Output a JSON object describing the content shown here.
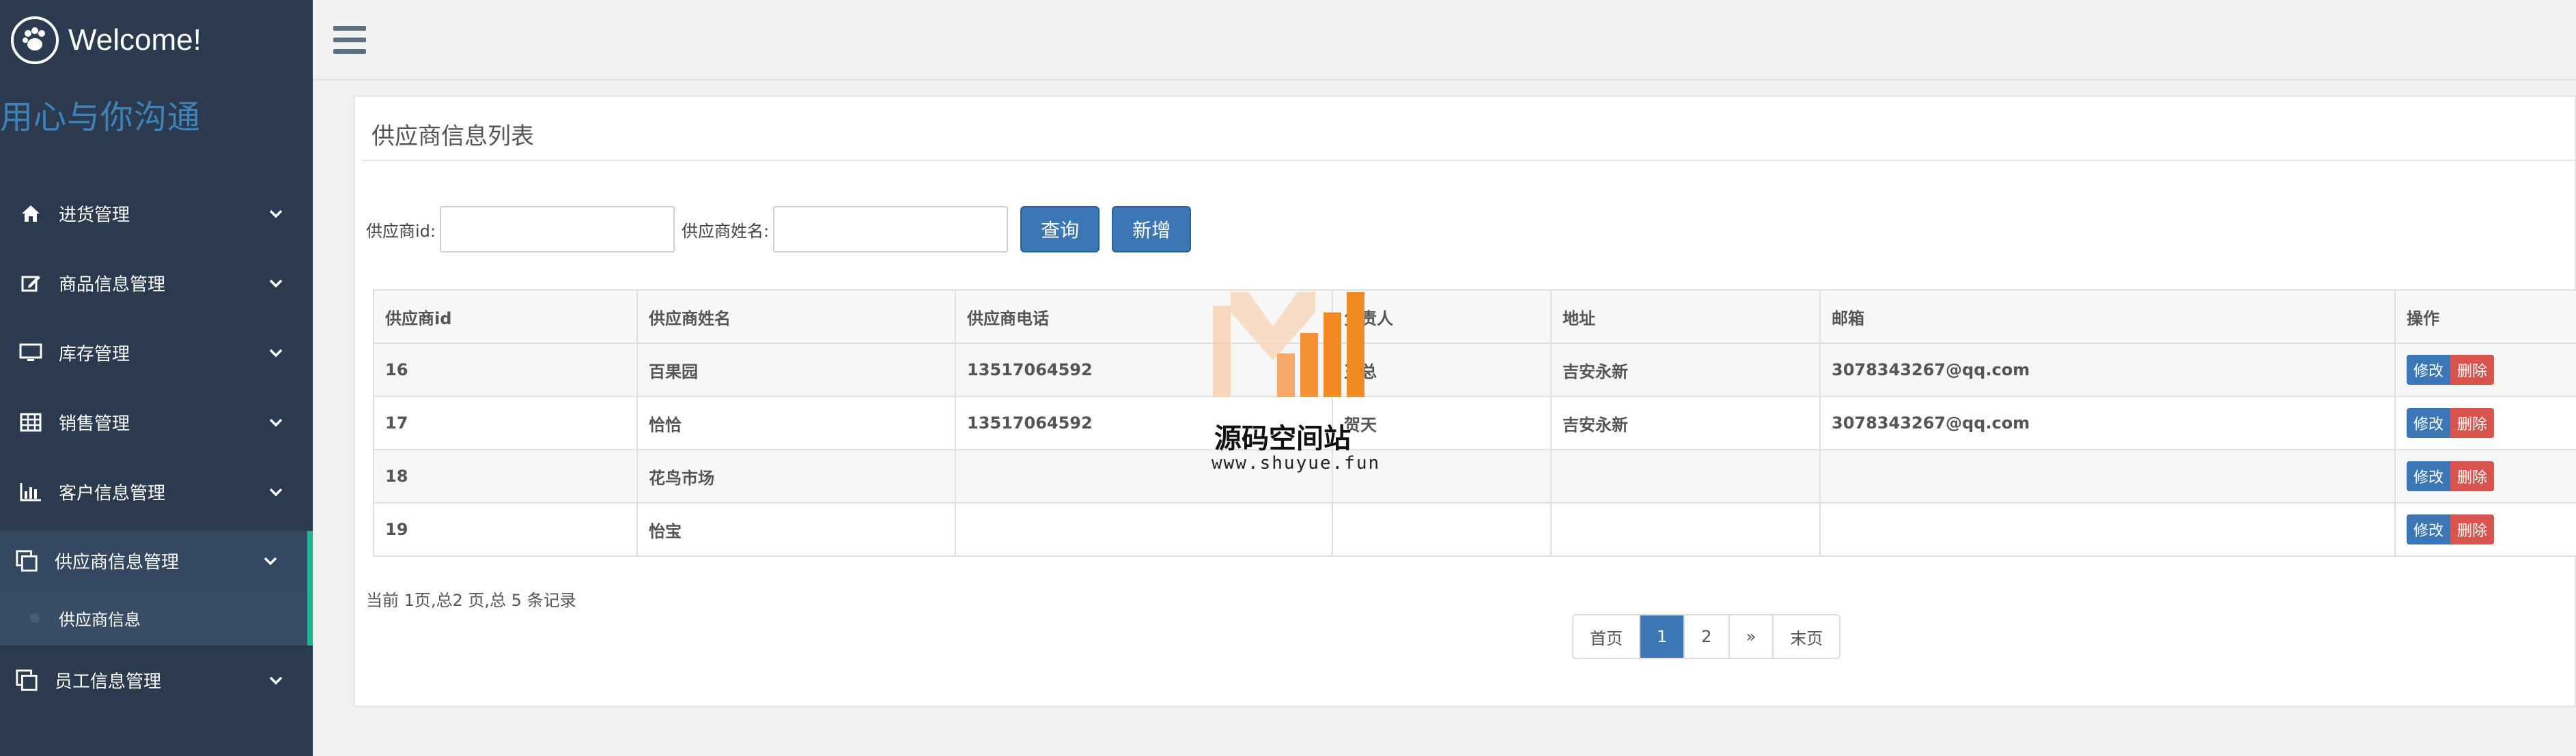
{
  "sidebar": {
    "brand_title": "Welcome!",
    "slogan": "用心与你沟通",
    "menu": [
      {
        "label": "进货管理",
        "icon": "home-icon"
      },
      {
        "label": "商品信息管理",
        "icon": "edit-icon"
      },
      {
        "label": "库存管理",
        "icon": "monitor-icon"
      },
      {
        "label": "销售管理",
        "icon": "table-icon"
      },
      {
        "label": "客户信息管理",
        "icon": "bar-chart-icon"
      },
      {
        "label": "供应商信息管理",
        "icon": "copy-icon",
        "active": true,
        "submenu": [
          {
            "label": "供应商信息"
          }
        ]
      },
      {
        "label": "员工信息管理",
        "icon": "copy-icon"
      }
    ],
    "accent_color": "#26b28a",
    "bg_color": "#2b3a4e"
  },
  "panel": {
    "title": "供应商信息列表",
    "search": {
      "id_label": "供应商id:",
      "id_value": "",
      "name_label": "供应商姓名:",
      "name_value": "",
      "query_button": "查询",
      "add_button": "新增"
    },
    "table": {
      "headers": [
        "供应商id",
        "供应商姓名",
        "供应商电话",
        "负责人",
        "地址",
        "邮箱",
        "操作"
      ],
      "rows": [
        [
          "16",
          "百果园",
          "13517064592",
          "王总",
          "吉安永新",
          "3078343267@qq.com"
        ],
        [
          "17",
          "恰恰",
          "13517064592",
          "贺天",
          "吉安永新",
          "3078343267@qq.com"
        ],
        [
          "18",
          "花鸟市场",
          "",
          "",
          "",
          ""
        ],
        [
          "19",
          "怡宝",
          "",
          "",
          "",
          ""
        ]
      ],
      "edit_label": "修改",
      "delete_label": "删除"
    },
    "page_info": "当前 1页,总2 页,总 5 条记录",
    "pager": {
      "first": "首页",
      "pages": [
        "1",
        "2"
      ],
      "next": "»",
      "last": "末页",
      "current": "1"
    }
  },
  "watermark": {
    "text": "源码空间站",
    "url": "www.shuyue.fun"
  }
}
